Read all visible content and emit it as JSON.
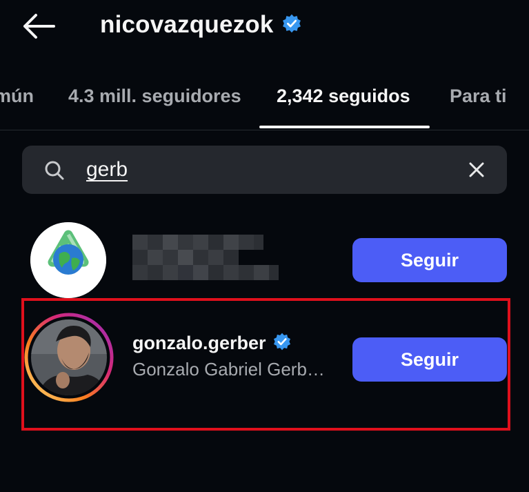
{
  "header": {
    "username": "nicovazquezok"
  },
  "tabs": [
    {
      "label": "mún"
    },
    {
      "label": "4.3 mill. seguidores"
    },
    {
      "label": "2,342 seguidos"
    },
    {
      "label": "Para ti"
    }
  ],
  "active_tab": "2,342 seguidos",
  "search": {
    "value": "gerb"
  },
  "results": [
    {
      "username_blurred": true,
      "button_label": "Seguir"
    },
    {
      "username": "gonzalo.gerber",
      "full_name": "Gonzalo Gabriel Gerb…",
      "verified": true,
      "button_label": "Seguir",
      "highlighted": true
    }
  ],
  "colors": {
    "background": "#05080d",
    "follow_button": "#4c5df6",
    "verified_badge": "#3897f0",
    "highlight_box": "#e0101c",
    "search_bg": "#25282e",
    "muted_text": "#a8abb0"
  },
  "icons": [
    "back-arrow-icon",
    "verified-badge-icon",
    "search-icon",
    "close-icon"
  ]
}
